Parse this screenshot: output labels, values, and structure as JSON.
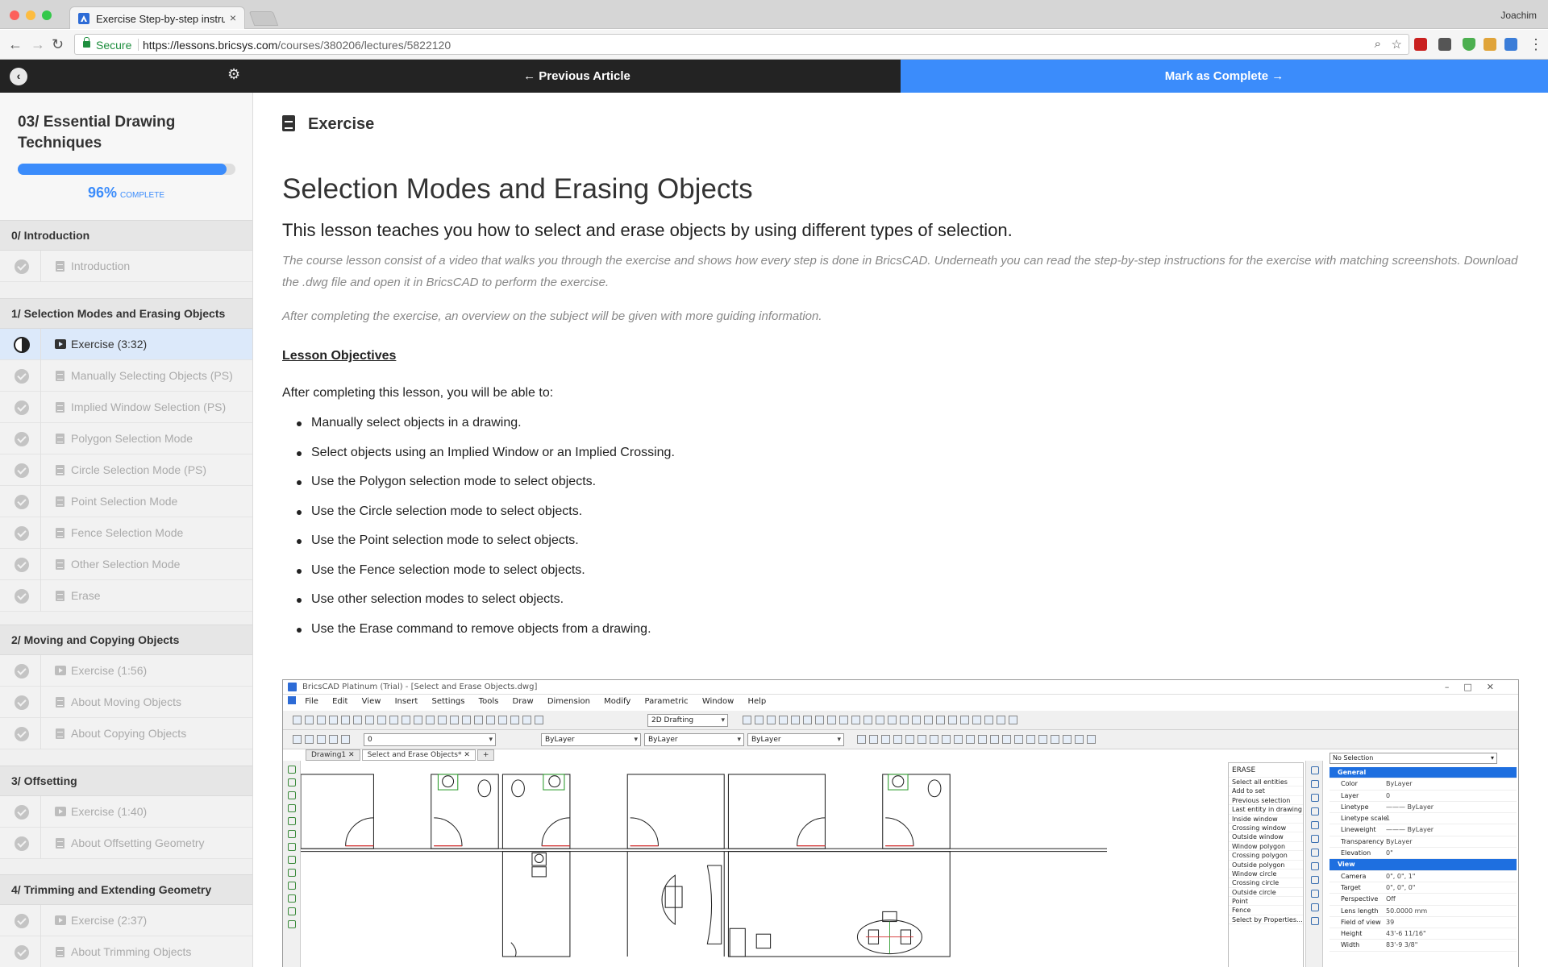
{
  "browser": {
    "tab_title": "Exercise Step-by-step instructions",
    "tab_close": "×",
    "profile_name": "Joachim",
    "secure_label": "Secure",
    "url_host": "https://lessons.bricsys.com",
    "url_path": "/courses/380206/lectures/5822120",
    "back_glyph": "←",
    "forward_glyph": "→",
    "reload_glyph": "↻",
    "zoom_glyph": "⌕",
    "star_glyph": "☆",
    "menu_glyph": "⋮"
  },
  "appbar": {
    "back_glyph": "‹",
    "gear_glyph": "⚙",
    "previous_label": "← Previous Article",
    "complete_label": "Mark as Complete →"
  },
  "sidebar": {
    "course_title": "03/ Essential Drawing Techniques",
    "progress_percent": 96,
    "progress_text": "96%",
    "complete_word": "COMPLETE",
    "sections": [
      {
        "title": "0/ Introduction",
        "items": [
          {
            "label": "Introduction"
          }
        ]
      },
      {
        "title": "1/ Selection Modes and Erasing Objects",
        "items": [
          {
            "label": "Exercise (3:32)"
          },
          {
            "label": "Manually Selecting Objects (PS)"
          },
          {
            "label": "Implied Window Selection (PS)"
          },
          {
            "label": "Polygon Selection Mode"
          },
          {
            "label": "Circle Selection Mode (PS)"
          },
          {
            "label": "Point Selection Mode"
          },
          {
            "label": "Fence Selection Mode"
          },
          {
            "label": "Other Selection Mode"
          },
          {
            "label": "Erase"
          }
        ]
      },
      {
        "title": "2/ Moving and Copying Objects",
        "items": [
          {
            "label": "Exercise (1:56)"
          },
          {
            "label": "About Moving Objects"
          },
          {
            "label": "About Copying Objects"
          }
        ]
      },
      {
        "title": "3/ Offsetting",
        "items": [
          {
            "label": "Exercise (1:40)"
          },
          {
            "label": "About Offsetting Geometry"
          }
        ]
      },
      {
        "title": "4/ Trimming and Extending Geometry",
        "items": [
          {
            "label": "Exercise (2:37)"
          },
          {
            "label": "About Trimming Objects"
          }
        ]
      }
    ]
  },
  "main": {
    "header": "Exercise",
    "title": "Selection Modes and Erasing Objects",
    "lead": "This lesson teaches you how to select and erase objects by using different types of selection.",
    "intro": "The course lesson consist of a video that walks you through the exercise and shows how every step is done in BricsCAD. Underneath you can read the step-by-step instructions for the exercise with matching screenshots. Download the .dwg file and open it in BricsCAD to perform the exercise.",
    "after": "After completing the exercise, an overview on the subject will be given with more guiding information.",
    "objectives_heading": "Lesson Objectives",
    "able": "After completing this lesson, you will be able to:",
    "objectives": [
      "Manually select objects in a drawing.",
      "Select objects using an Implied Window or an Implied Crossing.",
      "Use the Polygon selection mode to select objects.",
      "Use the Circle selection mode to select objects.",
      "Use the Point selection mode to select objects.",
      "Use the Fence selection mode to select objects.",
      "Use other selection modes to select objects.",
      "Use the Erase command to remove objects from a drawing."
    ]
  },
  "cad": {
    "title": "BricsCAD Platinum (Trial) - [Select and Erase Objects.dwg]",
    "window_buttons": "–□✕",
    "menu": [
      "File",
      "Edit",
      "View",
      "Insert",
      "Settings",
      "Tools",
      "Draw",
      "Dimension",
      "Modify",
      "Parametric",
      "Window",
      "Help"
    ],
    "workspace": "2D Drafting",
    "layer": "0",
    "bylayer_color": "ByLayer",
    "bylayer_linetype": "ByLayer",
    "bylayer_lineweight": "ByLayer",
    "tabs": [
      "Drawing1",
      "Select and Erase Objects*"
    ],
    "tab_close": "✕",
    "tab_add": "+",
    "erase_menu": {
      "header": "ERASE",
      "items": [
        "Select all entities",
        "Add to set",
        "Previous selection",
        "Last entity in drawing",
        "Inside window",
        "Crossing window",
        "Outside window",
        "Window polygon",
        "Crossing polygon",
        "Outside polygon",
        "Window circle",
        "Crossing circle",
        "Outside circle",
        "Point",
        "Fence",
        "Select by Properties..."
      ]
    },
    "properties": {
      "selection": "No Selection",
      "rows": [
        {
          "key": "General",
          "value": "",
          "header": true
        },
        {
          "key": "Color",
          "value": "ByLayer"
        },
        {
          "key": "Layer",
          "value": "0"
        },
        {
          "key": "Linetype",
          "value": "——— ByLayer"
        },
        {
          "key": "Linetype scale",
          "value": "1"
        },
        {
          "key": "Lineweight",
          "value": "——— ByLayer"
        },
        {
          "key": "Transparency",
          "value": "ByLayer"
        },
        {
          "key": "Elevation",
          "value": "0\""
        },
        {
          "key": "View",
          "value": "",
          "header": true
        },
        {
          "key": "Camera",
          "value": "0\", 0\", 1\""
        },
        {
          "key": "Target",
          "value": "0\", 0\", 0\""
        },
        {
          "key": "Perspective",
          "value": "Off"
        },
        {
          "key": "Lens length",
          "value": "50.0000 mm"
        },
        {
          "key": "Field of view",
          "value": "39"
        },
        {
          "key": "Height",
          "value": "43'-6 11/16\""
        },
        {
          "key": "Width",
          "value": "83'-9 3/8\""
        }
      ]
    }
  }
}
